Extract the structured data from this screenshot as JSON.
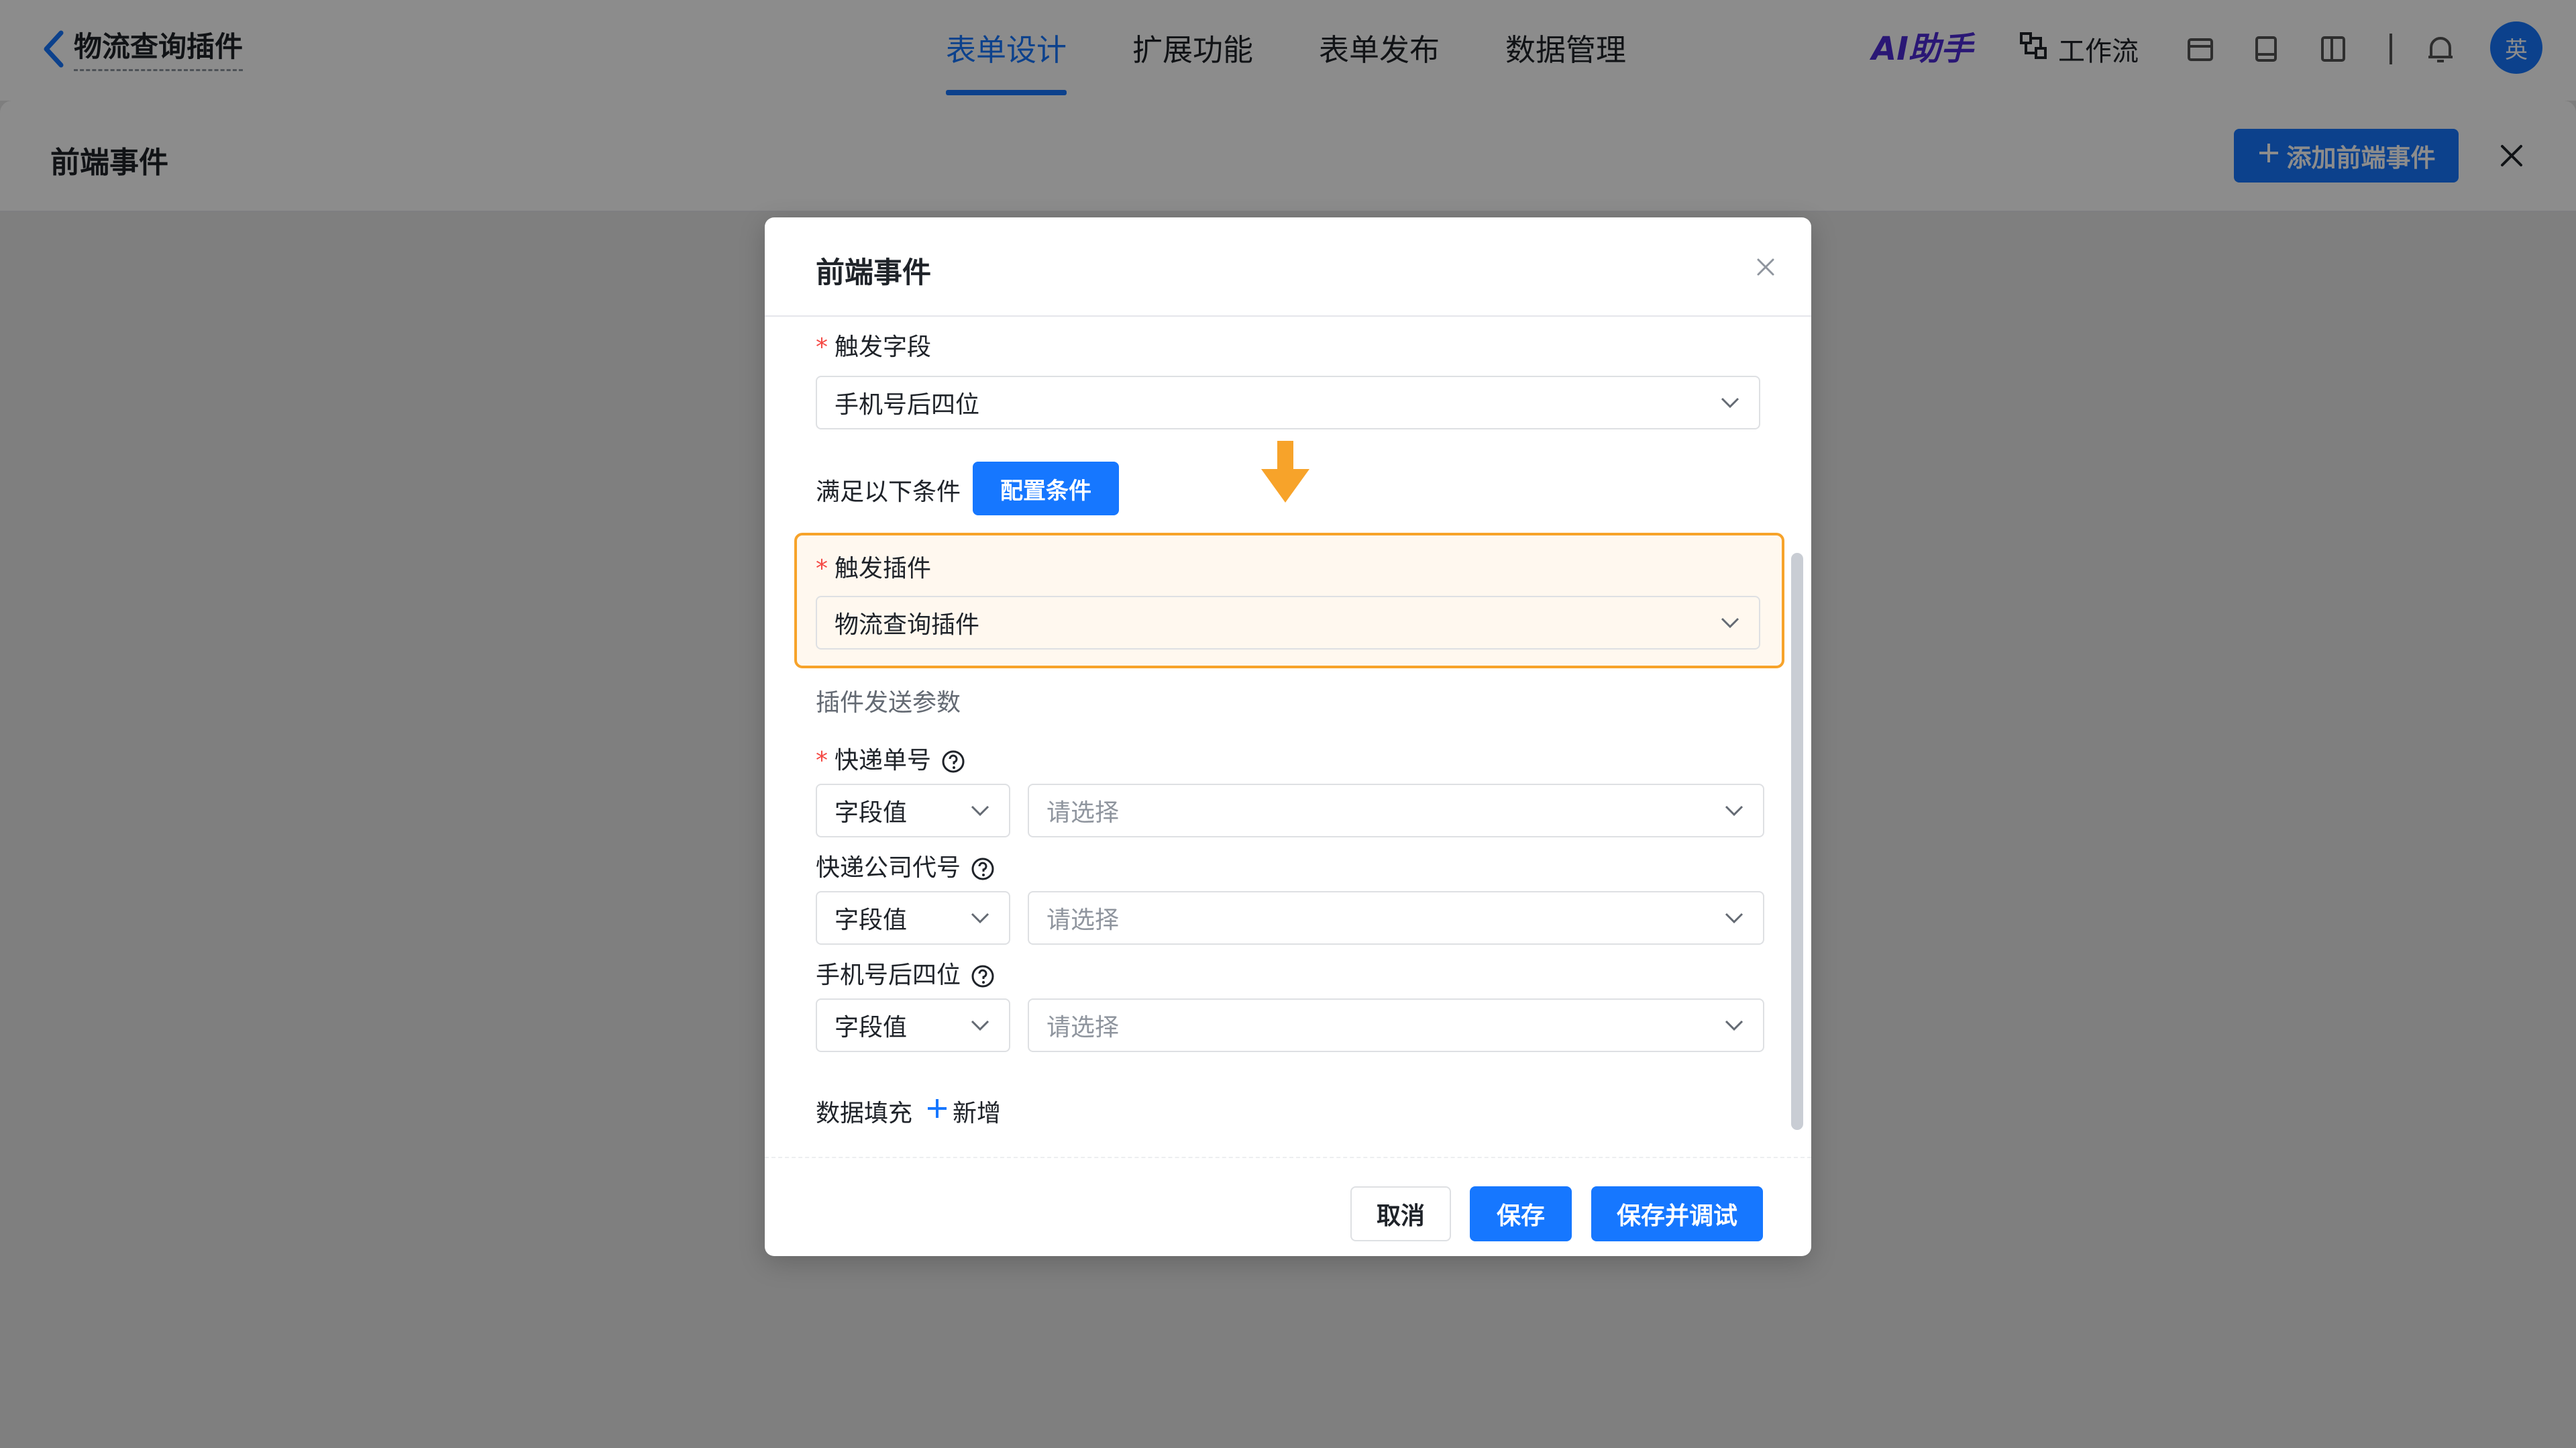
{
  "topbar": {
    "app_title": "物流查询插件",
    "nav": [
      "表单设计",
      "扩展功能",
      "表单发布",
      "数据管理"
    ],
    "active_nav": 0,
    "ai_label": "AI助手",
    "workflow_label": "工作流",
    "avatar_text": "英"
  },
  "drawer": {
    "title": "前端事件",
    "add_button": "添加前端事件"
  },
  "modal": {
    "title": "前端事件",
    "trigger_field": {
      "label": "触发字段",
      "value": "手机号后四位"
    },
    "condition": {
      "label": "满足以下条件",
      "button": "配置条件"
    },
    "trigger_plugin": {
      "label": "触发插件",
      "value": "物流查询插件"
    },
    "params_title": "插件发送参数",
    "params": [
      {
        "label": "快递单号",
        "required": true,
        "type": "字段值",
        "placeholder": "请选择"
      },
      {
        "label": "快递公司代号",
        "required": false,
        "type": "字段值",
        "placeholder": "请选择"
      },
      {
        "label": "手机号后四位",
        "required": false,
        "type": "字段值",
        "placeholder": "请选择"
      }
    ],
    "data_fill": {
      "label": "数据填充",
      "add": "新增"
    },
    "footer": {
      "cancel": "取消",
      "save": "保存",
      "save_debug": "保存并调试"
    }
  },
  "colors": {
    "primary": "#1677ff",
    "highlight": "#f7a32a",
    "required": "#f54a45"
  }
}
